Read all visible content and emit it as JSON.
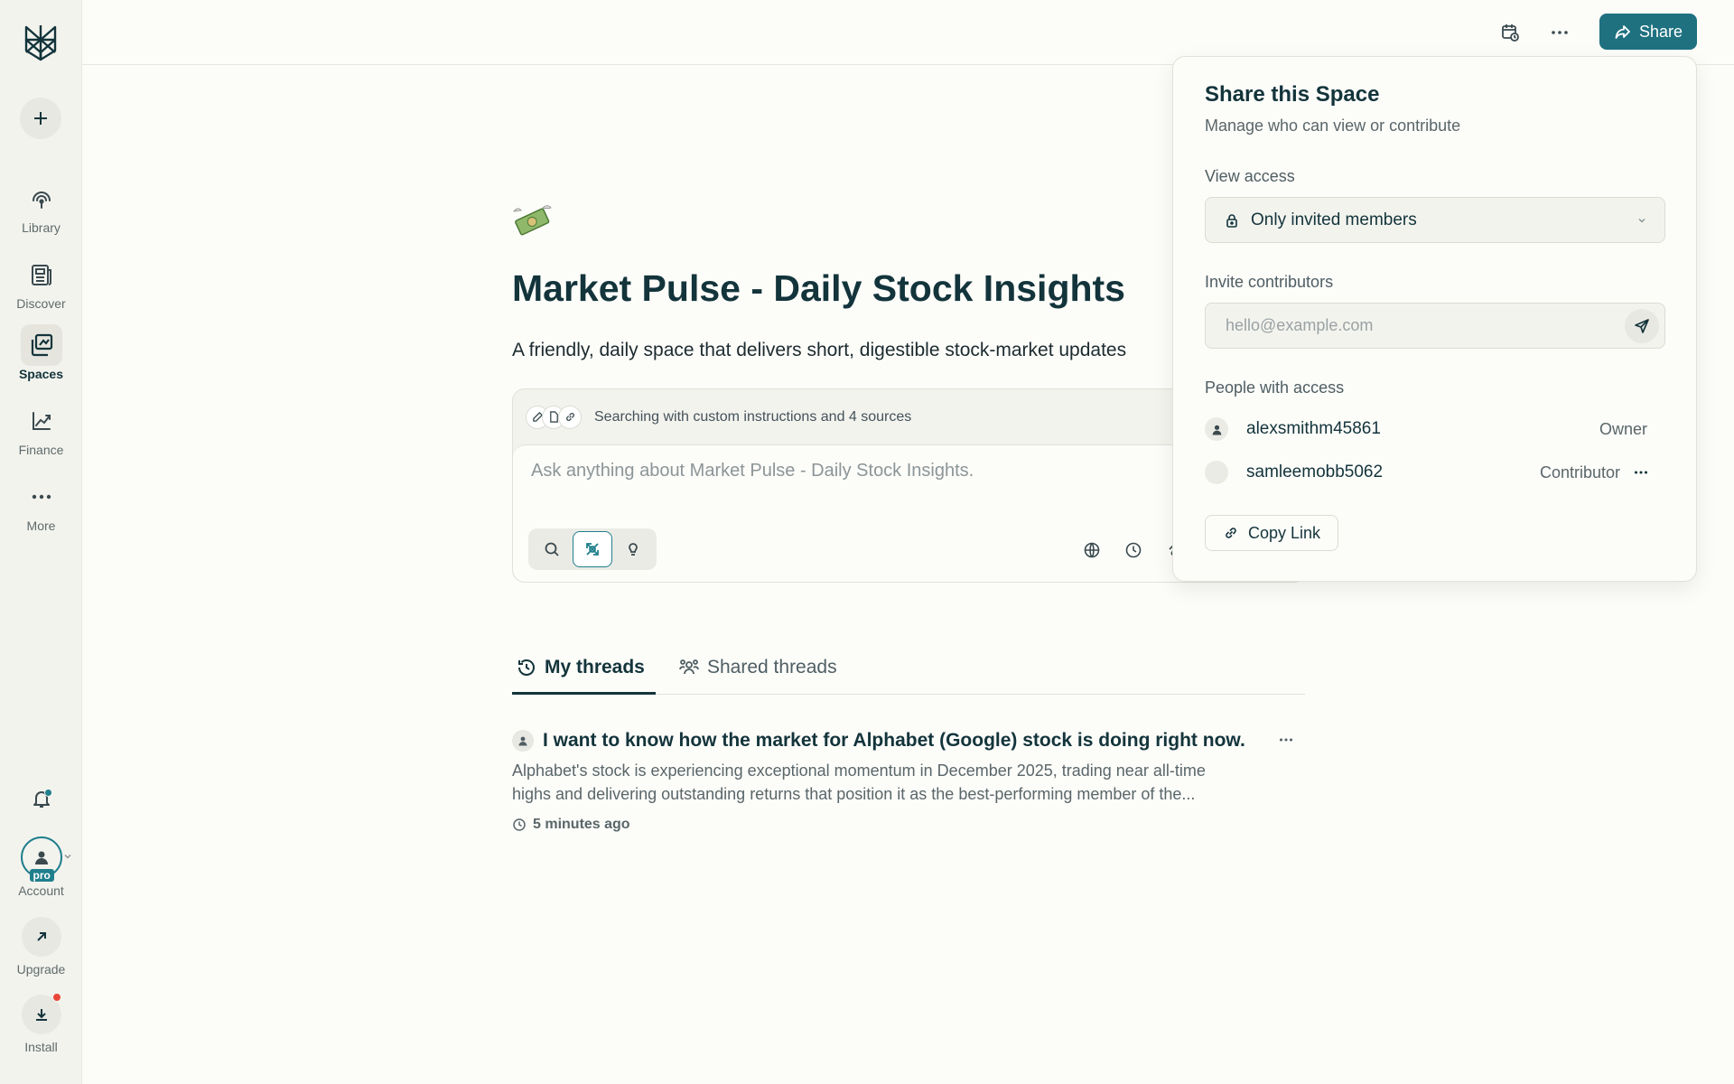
{
  "sidebar": {
    "nav": [
      {
        "label": "Library",
        "icon": "library-icon"
      },
      {
        "label": "Discover",
        "icon": "discover-icon"
      },
      {
        "label": "Spaces",
        "icon": "spaces-icon",
        "active": true
      },
      {
        "label": "Finance",
        "icon": "finance-icon"
      },
      {
        "label": "More",
        "icon": "more-icon"
      }
    ],
    "account_label": "Account",
    "pro_badge": "pro",
    "upgrade_label": "Upgrade",
    "install_label": "Install"
  },
  "topbar": {
    "share_label": "Share"
  },
  "space": {
    "emoji": "💸",
    "title": "Market Pulse - Daily Stock Insights",
    "description": "A friendly, daily space that delivers short, digestible stock-market updates"
  },
  "ask": {
    "sources_text": "Searching with custom instructions and 4 sources",
    "placeholder": "Ask anything about Market Pulse - Daily Stock Insights."
  },
  "tabs": [
    {
      "label": "My threads",
      "active": true
    },
    {
      "label": "Shared threads",
      "active": false
    }
  ],
  "threads": [
    {
      "title": "I want to know how the market for Alphabet (Google) stock is doing right now.",
      "snippet_line1": "Alphabet's stock is experiencing exceptional momentum in December 2025, trading near all-time",
      "snippet_line2": "highs and delivering outstanding returns that position it as the best-performing member of the...",
      "time": "5 minutes ago"
    }
  ],
  "share_popover": {
    "title": "Share this Space",
    "subtitle": "Manage who can view or contribute",
    "view_access_label": "View access",
    "view_access_value": "Only invited members",
    "invite_label": "Invite contributors",
    "invite_placeholder": "hello@example.com",
    "people_label": "People with access",
    "people": [
      {
        "name": "alexsmithm45861",
        "role": "Owner"
      },
      {
        "name": "samleemobb5062",
        "role": "Contributor"
      }
    ],
    "copy_link_label": "Copy Link"
  },
  "colors": {
    "accent": "#1f7180",
    "text": "#13343b",
    "sidebar_bg": "#f3f3ee",
    "page_bg": "#fcfcf9",
    "notification_dot": "#e8463a"
  }
}
